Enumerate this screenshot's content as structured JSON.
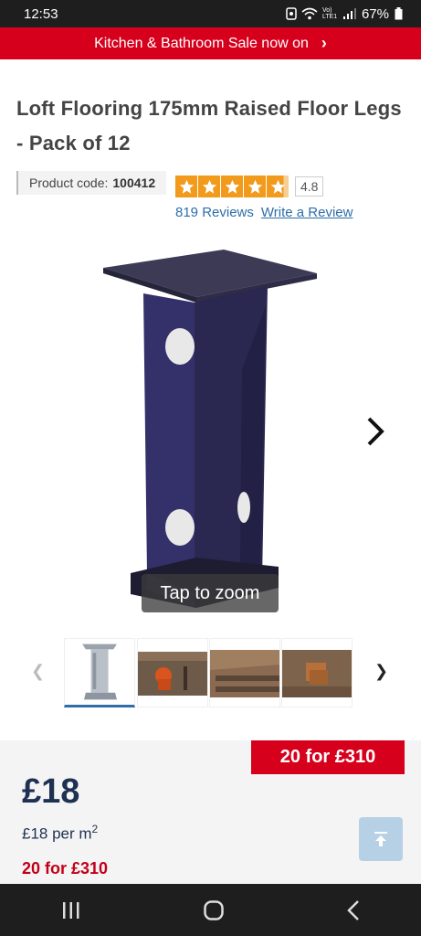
{
  "status_bar": {
    "time": "12:53",
    "battery": "67%",
    "network_label": "Vo) LTE1"
  },
  "promo": {
    "text": "Kitchen & Bathroom Sale now on",
    "chevron": "›"
  },
  "product": {
    "title": "Loft Flooring 175mm Raised Floor Legs - Pack of 12",
    "code_label": "Product code:",
    "code_value": "100412",
    "rating": "4.8",
    "reviews": "819 Reviews",
    "write_review": "Write a Review"
  },
  "gallery": {
    "zoom_label": "Tap to zoom",
    "thumbnails": [
      "floor-leg-product",
      "person-installing-in-loft",
      "loft-joists",
      "loft-boxes-on-boards"
    ]
  },
  "pricing": {
    "offer_badge": "20 for £310",
    "price": "£18",
    "per_unit": "£18 per m",
    "per_unit_sup": "2",
    "offer_text": "20 for £310"
  },
  "colors": {
    "brand_red": "#d6001c",
    "navy": "#1f3152",
    "link_blue": "#2f6ea8",
    "star_orange": "#f29a1b"
  },
  "icons": {
    "next": "chevron-right-icon",
    "prev": "chevron-left-icon",
    "back_to_top": "arrow-up-to-line-icon"
  }
}
